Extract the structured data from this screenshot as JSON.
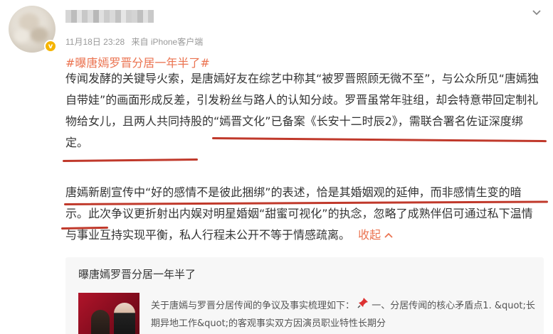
{
  "post": {
    "timestamp": "11月18日 23:28",
    "source": "来自 iPhone客户端",
    "topic": "#曝唐嫣罗晋分居一年半了#",
    "paragraph1": "传闻发酵的关键导火索，是唐嫣好友在综艺中称其“被罗晋照顾无微不至”，与公众所见“唐嫣独自带娃”的画面形成反差，引发粉丝与路人的认知分歧。罗晋虽常年驻组，却会特意带回定制礼物给女儿，且两人共同持股的“嫣晋文化”已备案《长安十二时辰2》，需联合署名佐证深度绑定。",
    "paragraph2": "唐嫣新剧宣传中“好的感情不是彼此捆绑”的表述，恰是其婚姻观的延伸，而非感情生变的暗示。此次争议更折射出内娱对明星婚姻“甜蜜可视化”的执念，忽略了成熟伴侣可通过私下温情与事业互持实现平衡，私人行程未公开不等于情感疏离。",
    "collapse_label": "收起",
    "collapse_icon": "chevron-up-icon",
    "more_icon": "chevron-down-icon"
  },
  "card": {
    "title": "曝唐嫣罗晋分居一年半了",
    "text_before_pin": "关于唐嫣与罗晋分居传闻的争议及事实梳理如下：",
    "pin_icon": "pushpin-icon",
    "text_after_pin": " 一、分居传闻的核心矛盾点1. &quot;长期异地工作&quot;的客观事实双方因演员职业特性长期分"
  },
  "colors": {
    "accent": "#eb7350",
    "highlight_line": "#c0392b",
    "verified_badge": "#f5b400"
  }
}
